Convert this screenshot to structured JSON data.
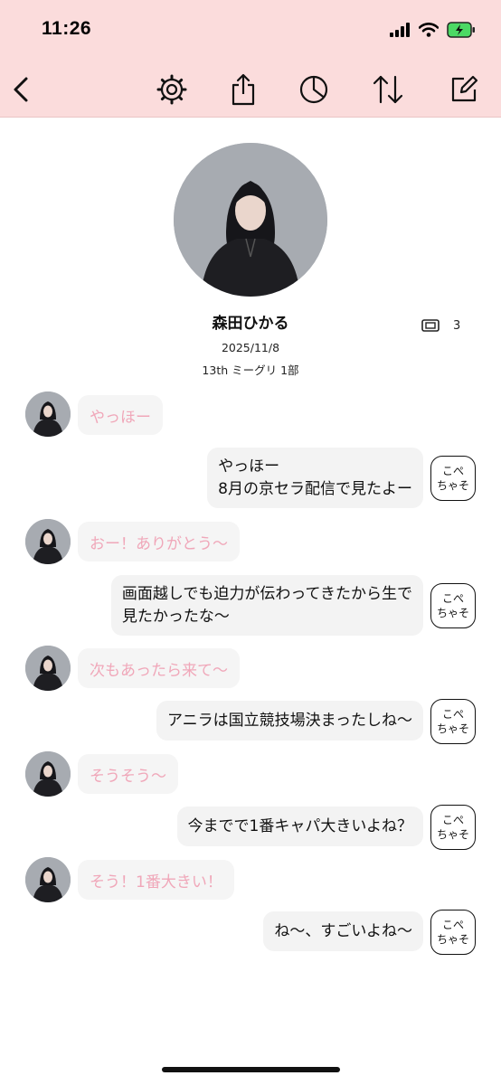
{
  "status_bar": {
    "time": "11:26"
  },
  "profile": {
    "name": "森田ひかる",
    "date": "2025/11/8",
    "event": "13th ミーグリ 1部",
    "ticket_count": "3"
  },
  "messages": [
    {
      "from": "member",
      "lines": [
        "やっほー"
      ]
    },
    {
      "from": "me",
      "lines": [
        "やっほー",
        "8月の京セラ配信で見たよー"
      ]
    },
    {
      "from": "member",
      "lines": [
        "おー！ありがとう〜"
      ]
    },
    {
      "from": "me",
      "lines": [
        "画面越しでも迫力が伝わってきたから生で",
        "見たかったな〜"
      ]
    },
    {
      "from": "member",
      "lines": [
        "次もあったら来て〜"
      ]
    },
    {
      "from": "me",
      "lines": [
        "アニラは国立競技場決まったしね〜"
      ]
    },
    {
      "from": "member",
      "lines": [
        "そうそう〜"
      ]
    },
    {
      "from": "me",
      "lines": [
        "今までで1番キャパ大きいよね？"
      ]
    },
    {
      "from": "member",
      "lines": [
        "そう！1番大きい！"
      ]
    },
    {
      "from": "me",
      "lines": [
        "ね〜、すごいよね〜"
      ]
    }
  ],
  "copy_button": {
    "line1": "こぺ",
    "line2": "ちゃそ"
  },
  "icons": [
    "back-icon",
    "settings-gear-icon",
    "share-icon",
    "pie-chart-icon",
    "sort-arrows-icon",
    "edit-icon",
    "ticket-icon",
    "signal-icon",
    "wifi-icon",
    "battery-icon"
  ],
  "colors": {
    "header_bg": "#fbdcdc",
    "member_text": "#f0a7b9",
    "bubble_bg": "#f3f3f3"
  }
}
